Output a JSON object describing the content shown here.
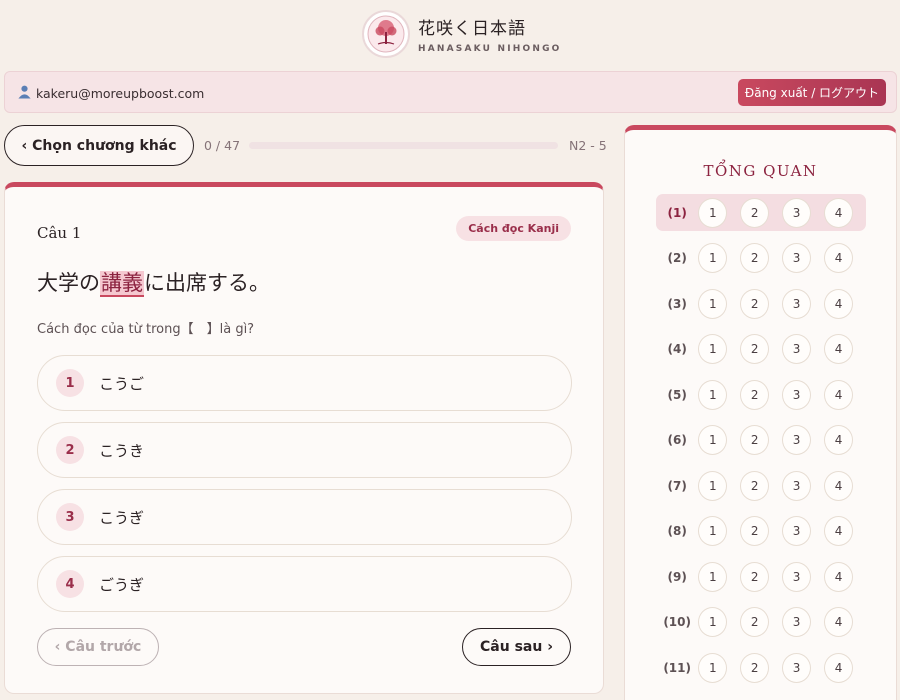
{
  "brand": {
    "name_jp": "花咲く日本語",
    "name_latin": "HANASAKU NIHONGO"
  },
  "user": {
    "email": "kakeru@moreupboost.com",
    "logout_label": "Đăng xuất / ログアウト"
  },
  "nav": {
    "chapter_button": "‹ Chọn chương khác",
    "progress_text": "0 / 47",
    "progress_fraction": 0,
    "level": "N2 - 5"
  },
  "question": {
    "number_label": "Câu 1",
    "type_badge": "Cách đọc Kanji",
    "sentence_before": "大学の",
    "sentence_highlight": "講義",
    "sentence_after": "に出席する。",
    "instruction": "Cách đọc của từ trong【　】là gì?",
    "options": [
      {
        "num": "1",
        "text": "こうご"
      },
      {
        "num": "2",
        "text": "こうき"
      },
      {
        "num": "3",
        "text": "こうぎ"
      },
      {
        "num": "4",
        "text": "ごうぎ"
      }
    ],
    "prev_label": "‹ Câu trước",
    "next_label": "Câu sau ›"
  },
  "overview": {
    "title": "TỔNG QUAN",
    "answer_labels": [
      "1",
      "2",
      "3",
      "4"
    ],
    "rows": [
      "(1)",
      "(2)",
      "(3)",
      "(4)",
      "(5)",
      "(6)",
      "(7)",
      "(8)",
      "(9)",
      "(10)",
      "(11)"
    ]
  },
  "colors": {
    "accent": "#c9495f",
    "accent_dark": "#8c2340",
    "background": "#f6efe9"
  }
}
